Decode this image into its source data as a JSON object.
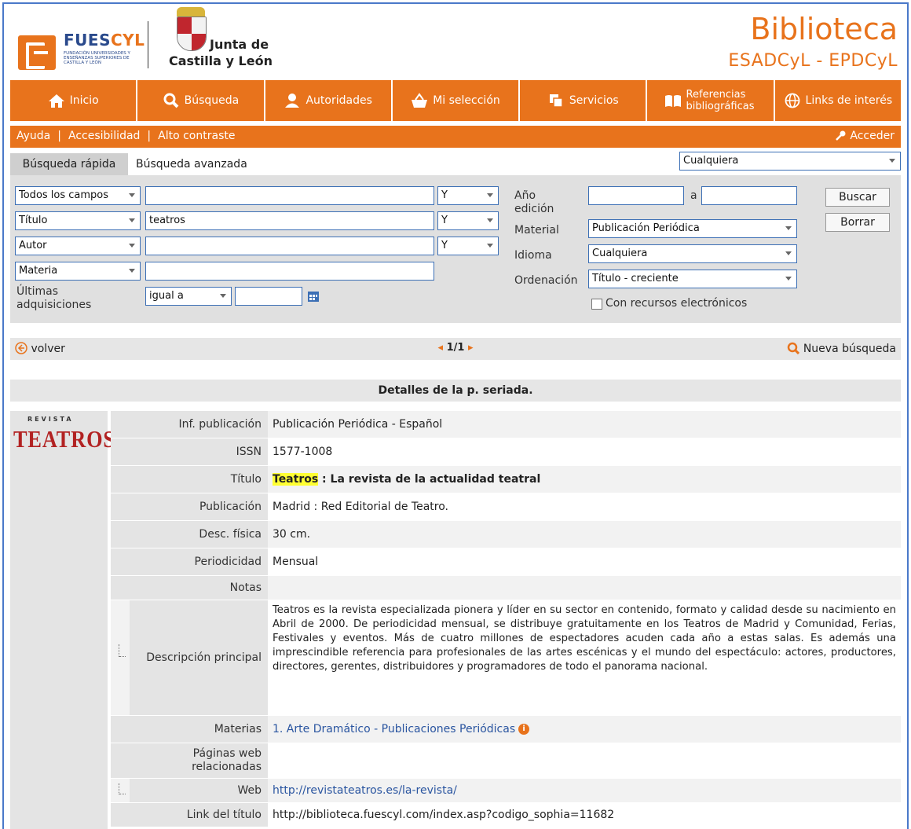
{
  "header": {
    "fues_name_a": "FUES",
    "fues_name_b": "CYL",
    "fues_sub": "Fundación Universidades y Enseñanzas Superiores de Castilla y León",
    "junta_line1": "Junta de",
    "junta_line2": "Castilla y León",
    "brand_title": "Biblioteca",
    "brand_sub": "ESADCyL - EPDCyL"
  },
  "nav": {
    "items": [
      {
        "label": "Inicio",
        "icon": "home-icon"
      },
      {
        "label": "Búsqueda",
        "icon": "search-icon"
      },
      {
        "label": "Autoridades",
        "icon": "users-icon"
      },
      {
        "label": "Mi selección",
        "icon": "basket-icon"
      },
      {
        "label": "Servicios",
        "icon": "copy-icon"
      },
      {
        "label": "Referencias bibliográficas",
        "icon": "book-icon"
      },
      {
        "label": "Links de interés",
        "icon": "globe-icon"
      }
    ]
  },
  "subnav": {
    "help": "Ayuda",
    "accessibility": "Accesibilidad",
    "contrast": "Alto contraste",
    "login": "Acceder"
  },
  "tabs": {
    "quick": "Búsqueda rápida",
    "advanced": "Búsqueda avanzada",
    "scope": "Cualquiera"
  },
  "search": {
    "field1": "Todos los campos",
    "field2": "Título",
    "field3": "Autor",
    "field4": "Materia",
    "value1": "",
    "value2": "teatros",
    "value3": "",
    "value4": "",
    "op1": "Y",
    "op2": "Y",
    "op3": "Y",
    "recent_label": "Últimas adquisiciones",
    "recent_op": "igual a",
    "recent_value": "",
    "year_label": "Año edición",
    "year_sep": "a",
    "material_label": "Material",
    "material_value": "Publicación Periódica",
    "language_label": "Idioma",
    "language_value": "Cualquiera",
    "order_label": "Ordenación",
    "order_value": "Título - creciente",
    "electronic_label": "Con recursos electrónicos",
    "search_button": "Buscar",
    "clear_button": "Borrar"
  },
  "pager": {
    "back": "volver",
    "pages": "1/1",
    "new_search": "Nueva búsqueda"
  },
  "section_title": "Detalles de la p. seriada.",
  "cover": {
    "kicker": "REVISTA",
    "title": "TEATROS"
  },
  "record": {
    "pub_info_label": "Inf. publicación",
    "pub_info_value": "Publicación Periódica - Español",
    "issn_label": "ISSN",
    "issn_value": "1577-1008",
    "title_label": "Título",
    "title_highlight": "Teatros",
    "title_rest": " : La revista de la actualidad teatral",
    "publication_label": "Publicación",
    "publication_value": "Madrid : Red Editorial de Teatro.",
    "physical_label": "Desc. física",
    "physical_value": "30 cm.",
    "frequency_label": "Periodicidad",
    "frequency_value": "Mensual",
    "notes_label": "Notas",
    "desc_label": "Descripción principal",
    "desc_value": "Teatros es la revista especializada pionera y líder en su sector en contenido, formato y calidad desde su nacimiento en Abril de 2000. De periodicidad mensual, se distribuye gratuitamente en los Teatros de Madrid y Comunidad, Ferias, Festivales y eventos. Más de cuatro millones de espectadores acuden cada año a estas salas. Es además una imprescindible referencia para profesionales de las artes escénicas y el mundo del espectáculo: actores, productores, directores, gerentes, distribuidores y programadores de todo el panorama nacional.",
    "subjects_label": "Materias",
    "subjects_value": "1. Arte Dramático - Publicaciones Periódicas",
    "webpages_label": "Páginas web relacionadas",
    "web_label": "Web",
    "web_value": "http://revistateatros.es/la-revista/",
    "link_label": "Link del título",
    "link_value": "http://biblioteca.fuescyl.com/index.asp?codigo_sophia=11682"
  },
  "colors": {
    "accent": "#e8731c",
    "highlight": "#ffff33",
    "link": "#2a55a0"
  }
}
